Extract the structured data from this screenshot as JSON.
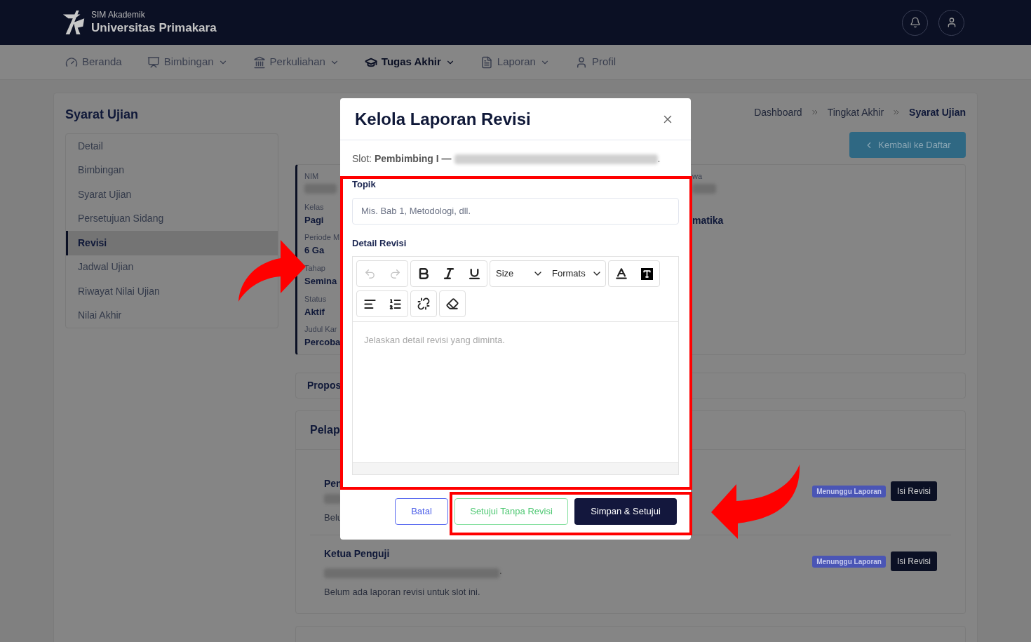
{
  "header": {
    "subtitle": "SIM Akademik",
    "title": "Universitas Primakara"
  },
  "nav": [
    {
      "label": "Beranda",
      "dropdown": false,
      "selected": false
    },
    {
      "label": "Bimbingan",
      "dropdown": true,
      "selected": false
    },
    {
      "label": "Perkuliahan",
      "dropdown": true,
      "selected": false
    },
    {
      "label": "Tugas Akhir",
      "dropdown": true,
      "selected": true
    },
    {
      "label": "Laporan",
      "dropdown": true,
      "selected": false
    },
    {
      "label": "Profil",
      "dropdown": false,
      "selected": false
    }
  ],
  "page": {
    "title": "Syarat Ujian",
    "breadcrumb": [
      {
        "label": "Dashboard",
        "current": false
      },
      {
        "label": "Tingkat Akhir",
        "current": false
      },
      {
        "label": "Syarat Ujian",
        "current": true
      }
    ],
    "back_button": "Kembali ke Daftar"
  },
  "sidebar": [
    {
      "label": "Detail",
      "selected": false
    },
    {
      "label": "Bimbingan",
      "selected": false
    },
    {
      "label": "Syarat Ujian",
      "selected": false
    },
    {
      "label": "Persetujuan Sidang",
      "selected": false
    },
    {
      "label": "Revisi",
      "selected": true
    },
    {
      "label": "Jadwal Ujian",
      "selected": false
    },
    {
      "label": "Riwayat Nilai Ujian",
      "selected": false
    },
    {
      "label": "Nilai Akhir",
      "selected": false
    }
  ],
  "info": {
    "left": [
      {
        "label": "NIM",
        "redacted": true
      },
      {
        "label": "Kelas",
        "value": "Pagi"
      },
      {
        "label": "Periode M",
        "value": "6 Ga"
      },
      {
        "label": "Tahap",
        "value": "Semina"
      },
      {
        "label": "Status",
        "value": "Aktif"
      },
      {
        "label": "Judul Kar",
        "value": "Percoba"
      }
    ],
    "right": [
      {
        "label": "wa",
        "redacted": true
      },
      {
        "value": "matika"
      }
    ]
  },
  "tab": {
    "label": "Propos"
  },
  "section": {
    "title": "Pelap",
    "slots": [
      {
        "role": "Pen",
        "redacted": true,
        "note": "Belu",
        "badge": "Menunggu Laporan",
        "button": "Isi Revisi"
      },
      {
        "role": "Ketua Penguji",
        "redacted": true,
        "suffix": ".",
        "note": "Belum ada laporan revisi untuk slot ini.",
        "badge": "Menunggu Laporan",
        "button": "Isi Revisi"
      }
    ]
  },
  "modal": {
    "title": "Kelola Laporan Revisi",
    "slot_prefix": "Slot: **Pembimbing I —**",
    "slot_redacted": true,
    "slot_suffix": ".",
    "fields": [
      {
        "label": "Topik",
        "kind": "input",
        "placeholder": "Mis. Bab 1, Metodologi, dll."
      },
      {
        "label": "Detail Revisi",
        "kind": "editor",
        "placeholder": "Jelaskan detail revisi yang diminta."
      }
    ],
    "toolbar": {
      "history_disabled": true,
      "dropdowns": [
        "Size",
        "Formats"
      ]
    },
    "buttons": [
      {
        "label": "Batal",
        "kind": "outline"
      },
      {
        "label": "Setujui Tanpa Revisi",
        "kind": "success"
      },
      {
        "label": "Simpan & Setujui",
        "kind": "primary"
      }
    ]
  }
}
